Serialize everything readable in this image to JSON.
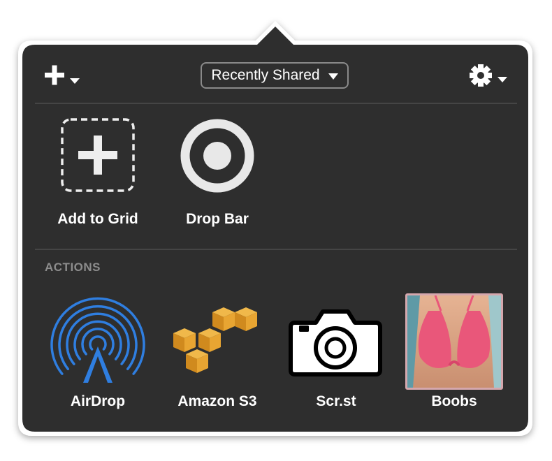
{
  "toolbar": {
    "add_menu_icon": "plus-icon",
    "filter_label": "Recently Shared",
    "settings_icon": "gear-icon"
  },
  "grid": {
    "items": [
      {
        "label": "Add to Grid",
        "icon": "dashed-plus-icon"
      },
      {
        "label": "Drop Bar",
        "icon": "target-icon"
      }
    ]
  },
  "actions": {
    "heading": "ACTIONS",
    "items": [
      {
        "label": "AirDrop",
        "icon": "airdrop-icon"
      },
      {
        "label": "Amazon S3",
        "icon": "amazon-s3-icon"
      },
      {
        "label": "Scr.st",
        "icon": "camera-icon"
      },
      {
        "label": "Boobs",
        "icon": "photo-thumbnail"
      }
    ]
  },
  "colors": {
    "panel_background": "#2e2e2e",
    "airdrop_blue": "#2f7ee0",
    "aws_orange": "#e8a532"
  }
}
